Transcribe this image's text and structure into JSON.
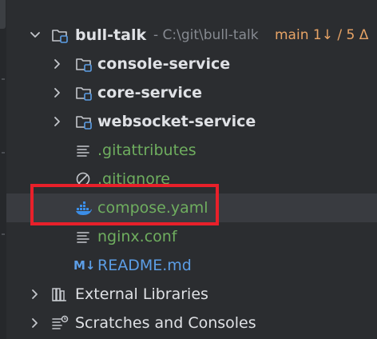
{
  "project": {
    "name": "bull-talk",
    "path": "- C:\\git\\bull-talk",
    "branch": "main 1↓ / 5 Δ"
  },
  "tree": {
    "folders": [
      {
        "label": "console-service"
      },
      {
        "label": "core-service"
      },
      {
        "label": "websocket-service"
      }
    ],
    "files": [
      {
        "label": ".gitattributes",
        "icon": "text-file-icon"
      },
      {
        "label": ".gitignore",
        "icon": "ignored-file-icon"
      },
      {
        "label": "compose.yaml",
        "icon": "docker-icon"
      },
      {
        "label": "nginx.conf",
        "icon": "text-file-icon"
      },
      {
        "label": "README.md",
        "icon": "markdown-icon"
      }
    ],
    "external_libraries": "External Libraries",
    "scratches": "Scratches and Consoles"
  },
  "colors": {
    "background": "#2b2d30",
    "selected_row": "#393b40",
    "highlight_box": "#e8202a",
    "git_added": "#6fae5f",
    "git_modified": "#5c9ee6",
    "branch": "#e8a466"
  },
  "markdown_icon_text": "M↓"
}
